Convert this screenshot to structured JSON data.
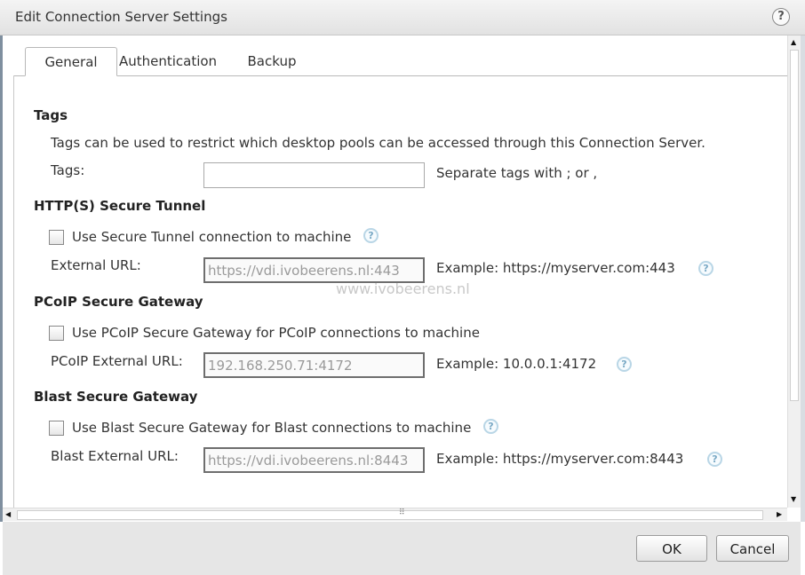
{
  "window": {
    "title": "Edit Connection Server Settings",
    "help": "?"
  },
  "tabs": [
    {
      "label": "General",
      "active": true
    },
    {
      "label": "Authentication",
      "active": false
    },
    {
      "label": "Backup",
      "active": false
    }
  ],
  "tags": {
    "heading": "Tags",
    "description": "Tags can be used to restrict which desktop pools can be accessed through this Connection Server.",
    "label": "Tags:",
    "value": "",
    "hint": "Separate tags with ; or ,"
  },
  "secure_tunnel": {
    "heading": "HTTP(S) Secure Tunnel",
    "checkbox_label": "Use Secure Tunnel connection to machine",
    "checked": false,
    "url_label": "External URL:",
    "url_value": "https://vdi.ivobeerens.nl:443",
    "example": "Example: https://myserver.com:443"
  },
  "pcoip": {
    "heading": "PCoIP Secure Gateway",
    "checkbox_label": "Use PCoIP Secure Gateway for PCoIP connections to machine",
    "checked": false,
    "url_label": "PCoIP External URL:",
    "url_value": "192.168.250.71:4172",
    "example": "Example: 10.0.0.1:4172"
  },
  "blast": {
    "heading": "Blast Secure Gateway",
    "checkbox_label": "Use Blast Secure Gateway for Blast connections to machine",
    "checked": false,
    "url_label": "Blast External URL:",
    "url_value": "https://vdi.ivobeerens.nl:8443",
    "example": "Example: https://myserver.com:8443"
  },
  "watermark": "www.ivobeerens.nl",
  "icons": {
    "help": "help-question-icon",
    "grip": "resize-grip-icon"
  },
  "buttons": {
    "ok": "OK",
    "cancel": "Cancel"
  }
}
